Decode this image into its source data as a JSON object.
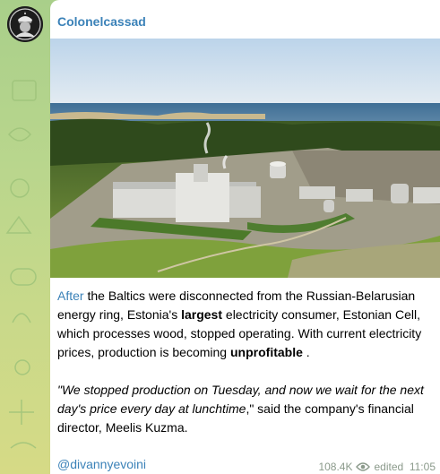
{
  "channel": {
    "name": "Colonelcassad",
    "avatar_icon": "soldier-emblem-icon"
  },
  "post": {
    "image_alt_icon": "industrial-plant-photo",
    "paragraph1": {
      "link_word": "After",
      "part1": " the Baltics were disconnected from the Russian-Belarusian energy ring, Estonia's ",
      "bold1": "largest",
      "part2": " electricity consumer, Estonian Cell, which processes wood, stopped operating. With current electricity prices, production is becoming ",
      "bold2": "unprofitable",
      "part3": " ."
    },
    "paragraph2": {
      "quote": "\"We stopped production on Tuesday, and now we wait for the next day's price every day at lunchtime",
      "rest": ",\" said the company's financial director, Meelis Kuzma."
    },
    "footer_link": "@divannyevoini"
  },
  "meta": {
    "views": "108.4K",
    "views_icon": "eye-icon",
    "edited_time": "edited  11:05"
  },
  "colors": {
    "accent": "#3b82b8",
    "wallpaper": "#b9d68d"
  }
}
